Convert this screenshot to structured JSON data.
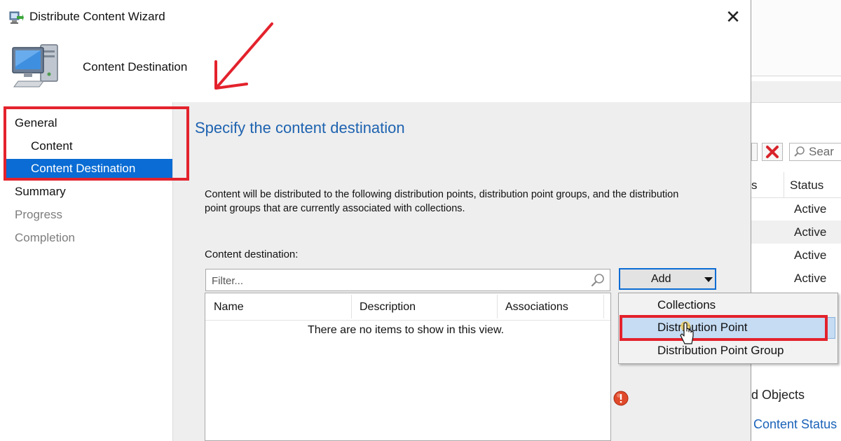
{
  "wizard": {
    "title": "Distribute Content Wizard",
    "close_glyph": "✕",
    "header_title": "Content Destination",
    "nav": {
      "general": "General",
      "content": "Content",
      "content_destination": "Content Destination",
      "summary": "Summary",
      "progress": "Progress",
      "completion": "Completion"
    },
    "page_heading": "Specify the content destination",
    "description": "Content will be distributed to the following distribution points, distribution point groups, and the distribution point groups that are currently associated with collections.",
    "destination_label": "Content destination:",
    "filter_placeholder": "Filter...",
    "list": {
      "columns": [
        "Name",
        "Description",
        "Associations"
      ],
      "empty_text": "There are no items to show in this view."
    },
    "add_button": "Add",
    "add_menu": [
      "Collections",
      "Distribution Point",
      "Distribution Point Group"
    ]
  },
  "background_console": {
    "search_text": "Sear",
    "columns": [
      "s",
      "Status"
    ],
    "rows": [
      "Active",
      "Active",
      "Active",
      "Active"
    ],
    "objects_text": "d Objects",
    "content_status_link": "Content Status"
  },
  "colors": {
    "selection_blue": "#0a6cd4",
    "heading_blue": "#1e63b0",
    "annotation_red": "#e3222c",
    "menu_highlight": "#c5dcf3"
  }
}
